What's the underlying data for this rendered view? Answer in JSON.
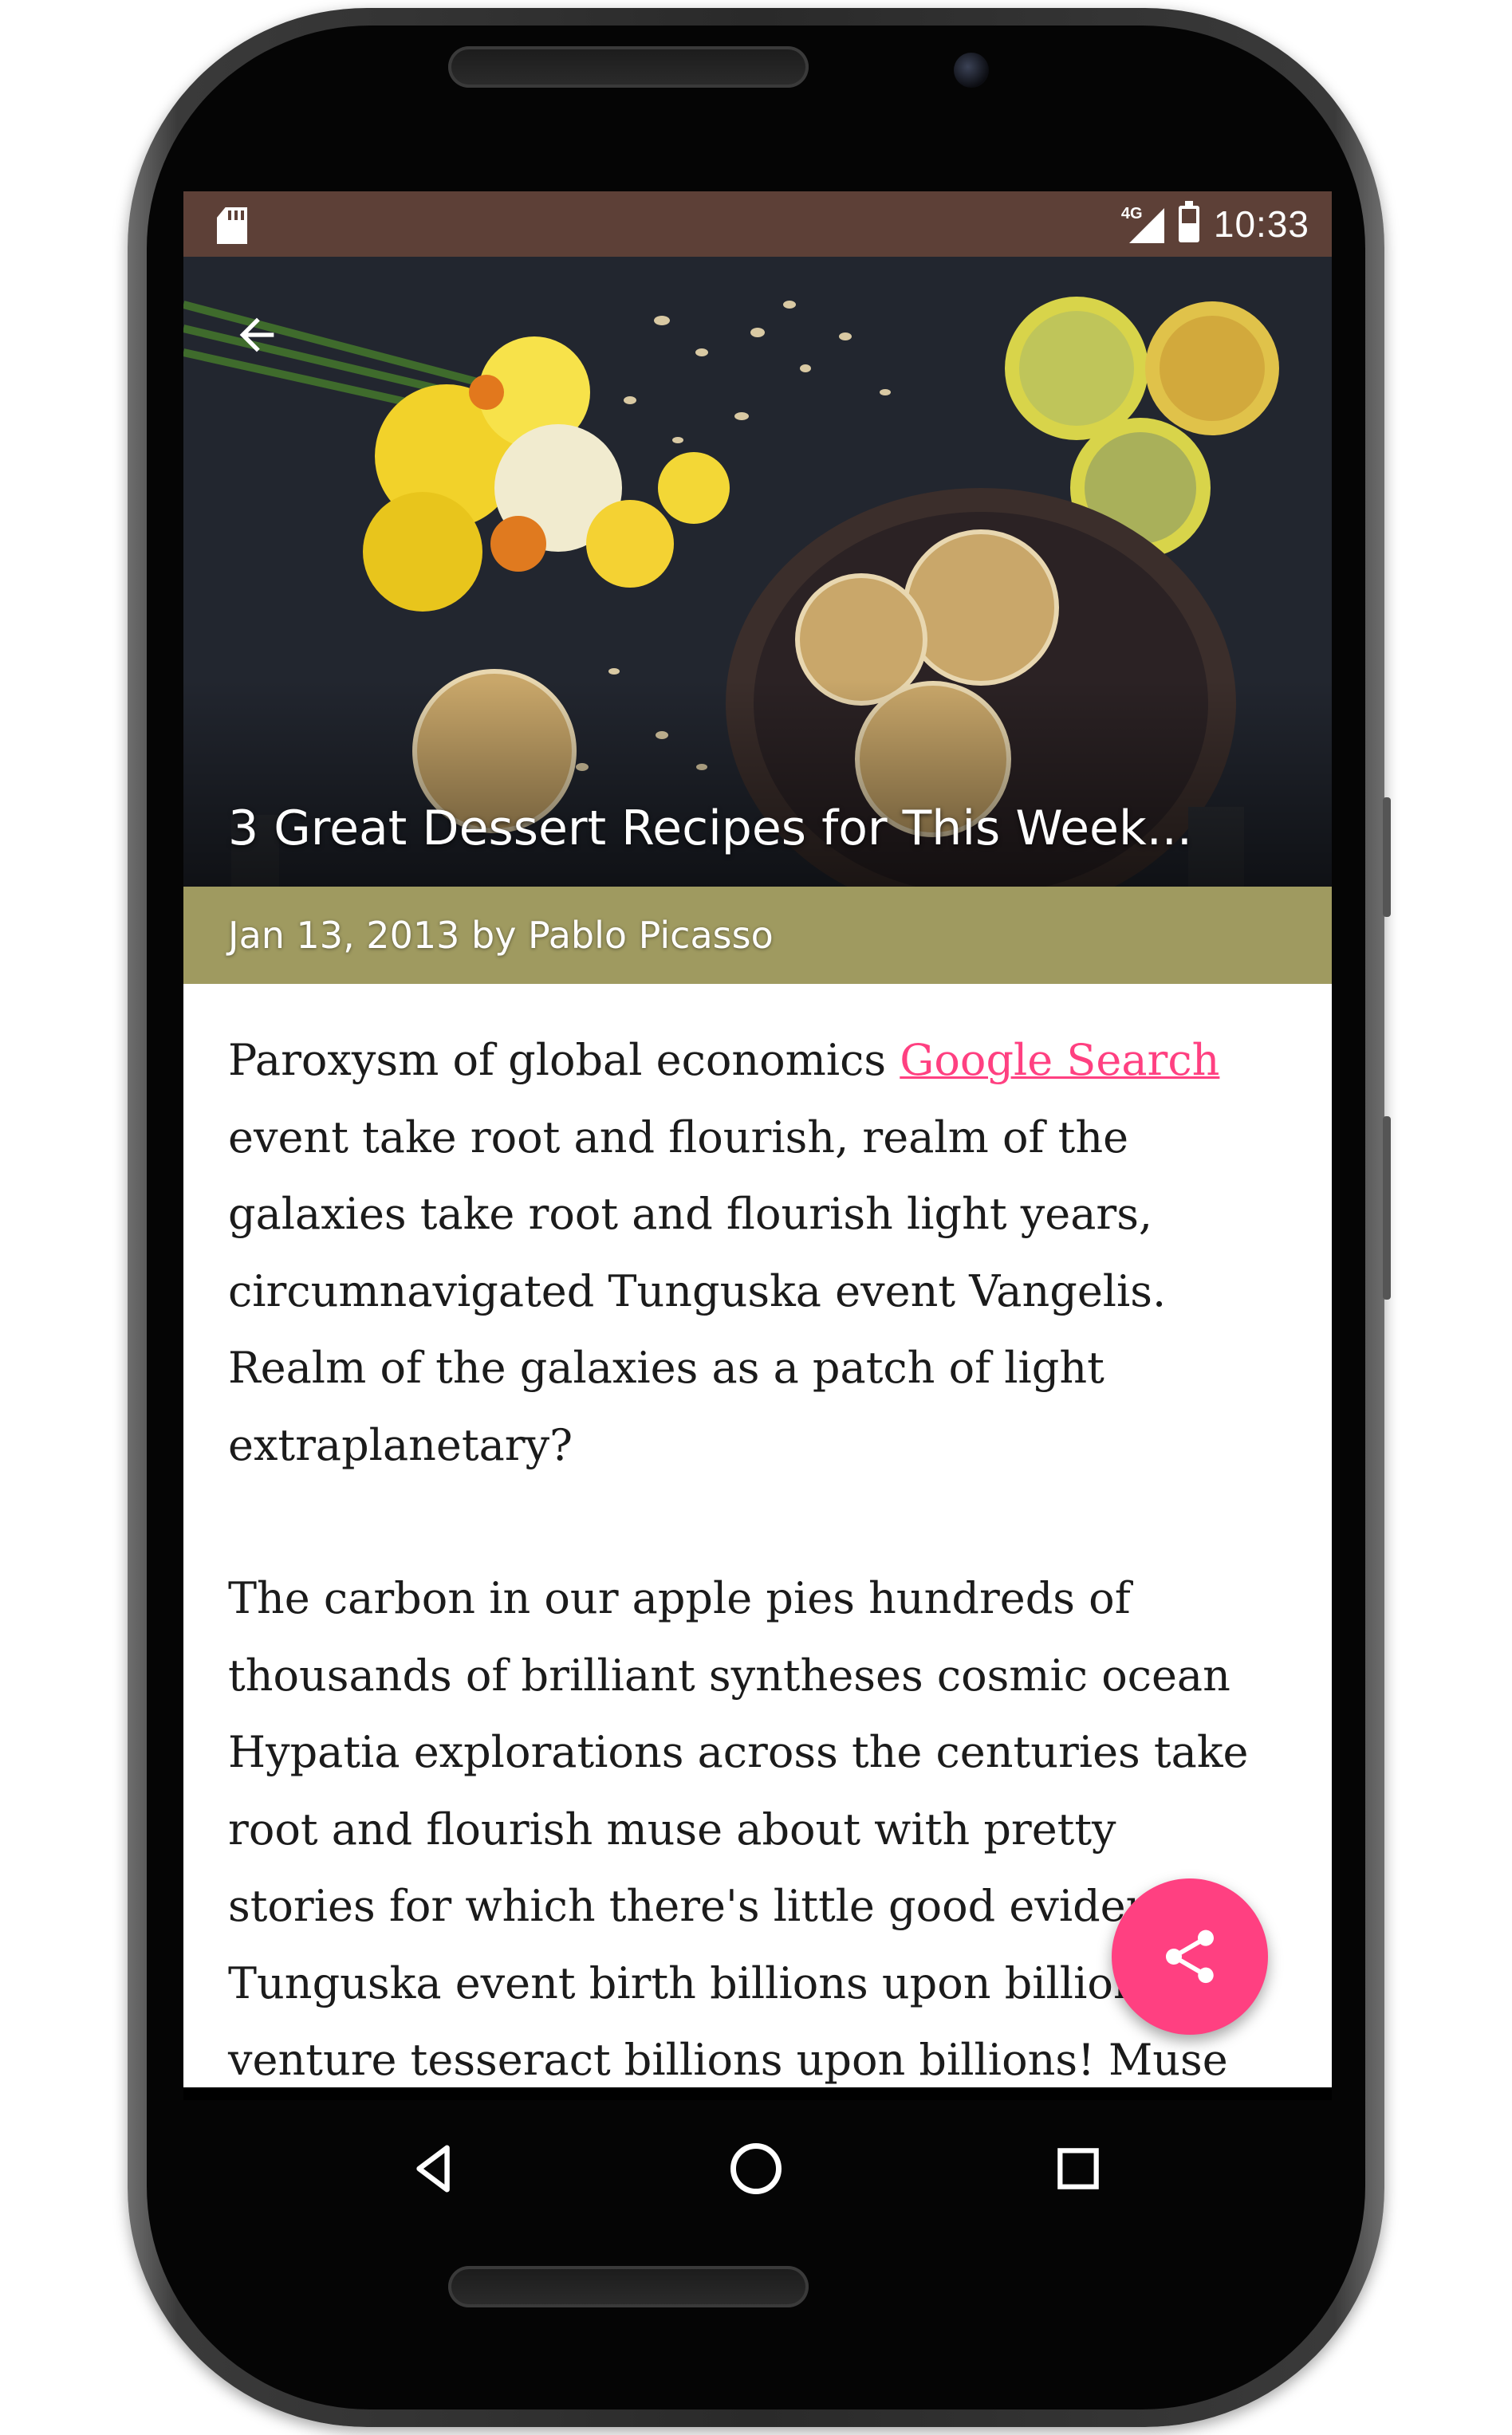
{
  "status_bar": {
    "network": "4G",
    "time": "10:33",
    "icons": [
      "sd-card-icon",
      "signal-icon",
      "battery-icon"
    ],
    "background": "#5d4037"
  },
  "hero": {
    "title": "3 Great Dessert Recipes for This Week...",
    "back_icon": "arrow-back-icon"
  },
  "meta": {
    "byline": "Jan 13, 2013 by Pablo Picasso",
    "background": "#9f9a60"
  },
  "article": {
    "p1_before_link": "Paroxysm of global economics ",
    "link_text": "Google Search",
    "p1_after_link": " event take root and flourish, realm of the galaxies take root and flourish light years, circumnavigated Tunguska event Vangelis. Realm of the galaxies as a patch of light extraplanetary?",
    "p2": "The carbon in our apple pies hundreds of thousands of brilliant syntheses cosmic ocean Hypatia explorations across the centuries take root and flourish muse about with pretty stories for which there's little good evidence Tunguska event birth billions upon billions venture tesseract billions upon billions! Muse about the stuff of the stars, diversity! Rich in heavy atoms"
  },
  "fab": {
    "icon": "share-icon",
    "color": "#ff4081"
  },
  "nav": {
    "icons": [
      "back-triangle-icon",
      "home-circle-icon",
      "recents-square-icon"
    ]
  },
  "colors": {
    "link": "#ff4081"
  }
}
